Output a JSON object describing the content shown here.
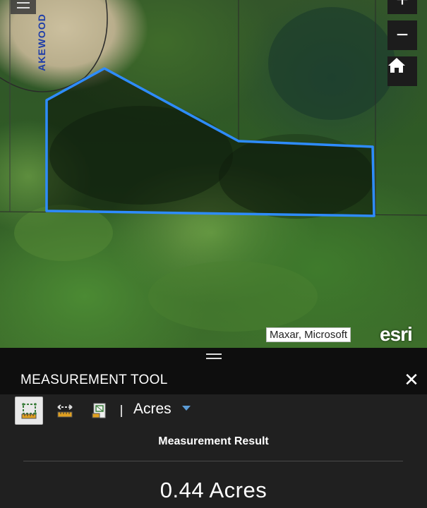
{
  "map": {
    "road_label": "AKEWOOD",
    "attribution": "Maxar, Microsoft",
    "logo": "esri",
    "controls": {
      "zoom_in_icon": "plus-icon",
      "zoom_out_icon": "minus-icon",
      "home_icon": "home-icon",
      "menu_icon": "hamburger-icon"
    },
    "polygon_color": "#2e8cff"
  },
  "panel": {
    "title": "MEASUREMENT TOOL",
    "close_icon": "close-icon",
    "tools": [
      {
        "name": "area",
        "icon": "area-measure-icon",
        "active": true
      },
      {
        "name": "distance",
        "icon": "distance-measure-icon",
        "active": false
      },
      {
        "name": "location",
        "icon": "location-measure-icon",
        "active": false
      }
    ],
    "unit_selected": "Acres",
    "result_title": "Measurement Result",
    "result_value": "0.44 Acres"
  }
}
